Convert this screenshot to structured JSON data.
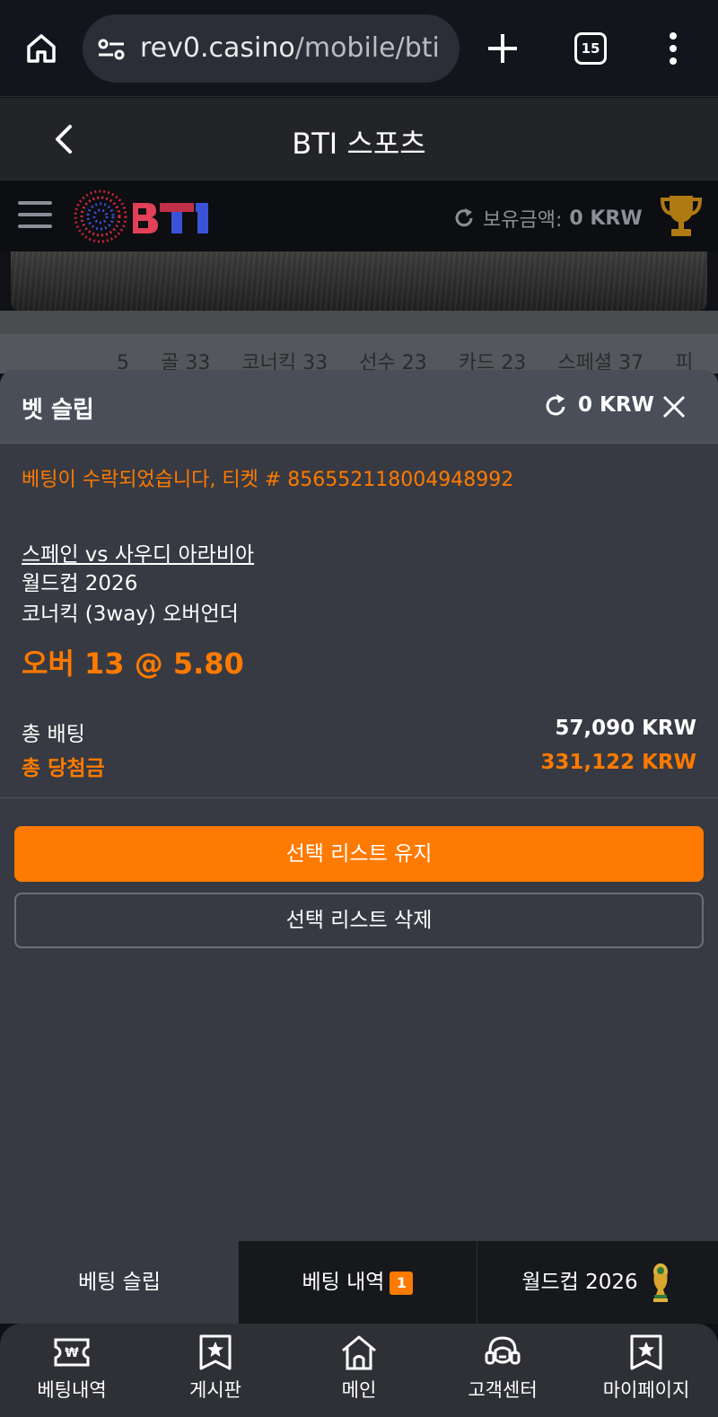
{
  "browser": {
    "url_domain": "rev0.casino",
    "url_path": "/mobile/bti",
    "tab_count": "15"
  },
  "app_header": {
    "title": "BTI 스포츠"
  },
  "bti_header": {
    "logo_text": "BTi",
    "balance_label": "보유금액:",
    "balance_value": "0 KRW"
  },
  "background_tabs": [
    "5",
    "골 33",
    "코너킥 33",
    "선수 23",
    "카드 23",
    "스페셜 37",
    "피"
  ],
  "bet_slip": {
    "title": "벳 슬립",
    "balance": "0 KRW",
    "accepted_message": "베팅이 수락되었습니다, 티켓 # 856552118004948992",
    "match": "스페인 vs 사우디 아라비아",
    "league": "월드컵 2026",
    "market": "코너킥 (3way) 오버언더",
    "selection": "오버 13 @ 5.80",
    "total_stake_label": "총 배팅",
    "total_stake_value": "57,090 KRW",
    "total_win_label": "총 당첨금",
    "total_win_value": "331,122 KRW",
    "keep_button": "선택 리스트 유지",
    "delete_button": "선택 리스트 삭제"
  },
  "slip_tabs": {
    "tab1": "베팅 슬립",
    "tab2": "베팅 내역",
    "tab2_badge": "1",
    "tab3": "월드컵 2026"
  },
  "bottom_nav": [
    {
      "label": "베팅내역",
      "icon": "ticket-won-icon"
    },
    {
      "label": "게시판",
      "icon": "star-bookmark-icon"
    },
    {
      "label": "메인",
      "icon": "home-icon"
    },
    {
      "label": "고객센터",
      "icon": "headset-icon"
    },
    {
      "label": "마이페이지",
      "icon": "star-bookmark-icon"
    }
  ],
  "colors": {
    "accent": "#ff7a00",
    "sheet_bg": "#373a42",
    "sheet_header": "#4a4e59"
  }
}
